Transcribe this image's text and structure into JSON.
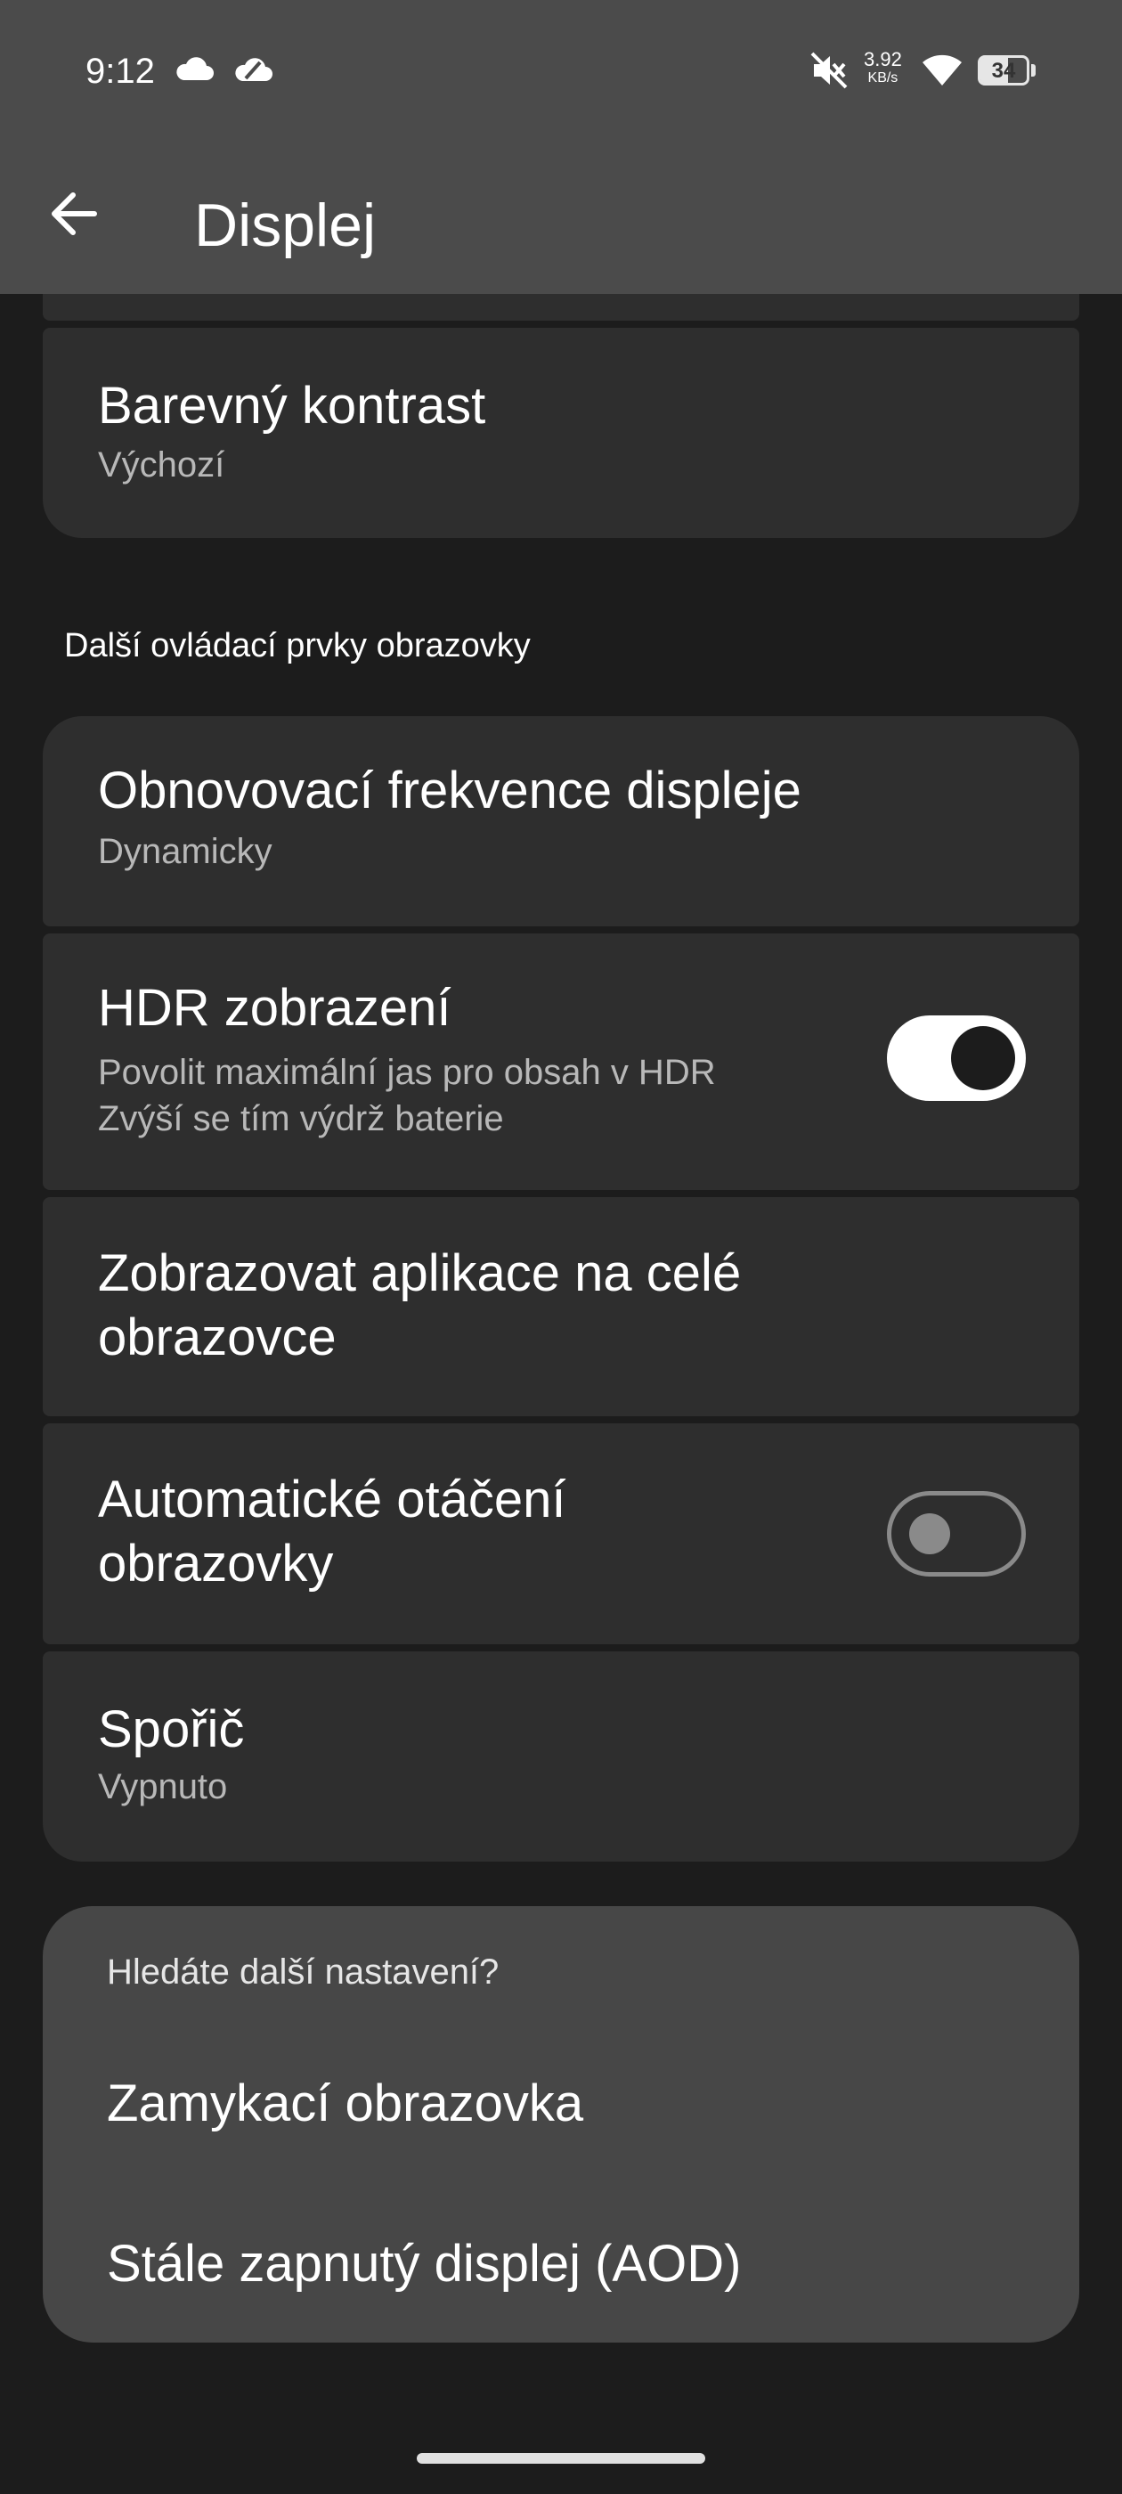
{
  "status_bar": {
    "time": "9:12",
    "net_speed_value": "3.92",
    "net_speed_unit": "KB/s",
    "battery": "34",
    "icons": [
      "cloud-icon",
      "weather-cloud-icon",
      "mute-icon",
      "wifi-icon",
      "battery-icon"
    ]
  },
  "header": {
    "title": "Displej"
  },
  "items": {
    "contrast": {
      "title": "Barevný kontrast",
      "subtitle": "Výchozí"
    },
    "section_header": "Další ovládací prvky obrazovky",
    "refresh": {
      "title": "Obnovovací frekvence displeje",
      "subtitle": "Dynamicky"
    },
    "hdr": {
      "title": "HDR zobrazení",
      "subtitle_line1": "Povolit maximální jas pro obsah v HDR",
      "subtitle_line2": "Zvýší se tím výdrž baterie",
      "enabled": true
    },
    "fullscreen": {
      "title_line1": "Zobrazovat aplikace na celé",
      "title_line2": "obrazovce"
    },
    "rotate": {
      "title_line1": "Automatické otáčení",
      "title_line2": "obrazovky",
      "enabled": false
    },
    "saver": {
      "title": "Spořič",
      "subtitle": "Vypnuto"
    }
  },
  "search_more": {
    "heading": "Hledáte další nastavení?",
    "links": [
      "Zamykací obrazovka",
      "Stále zapnutý displej (AOD)"
    ]
  },
  "colors": {
    "background": "#1c1c1c",
    "card": "#2e2e2e",
    "topbar": "#4b4b4b",
    "search_card": "#474747"
  }
}
